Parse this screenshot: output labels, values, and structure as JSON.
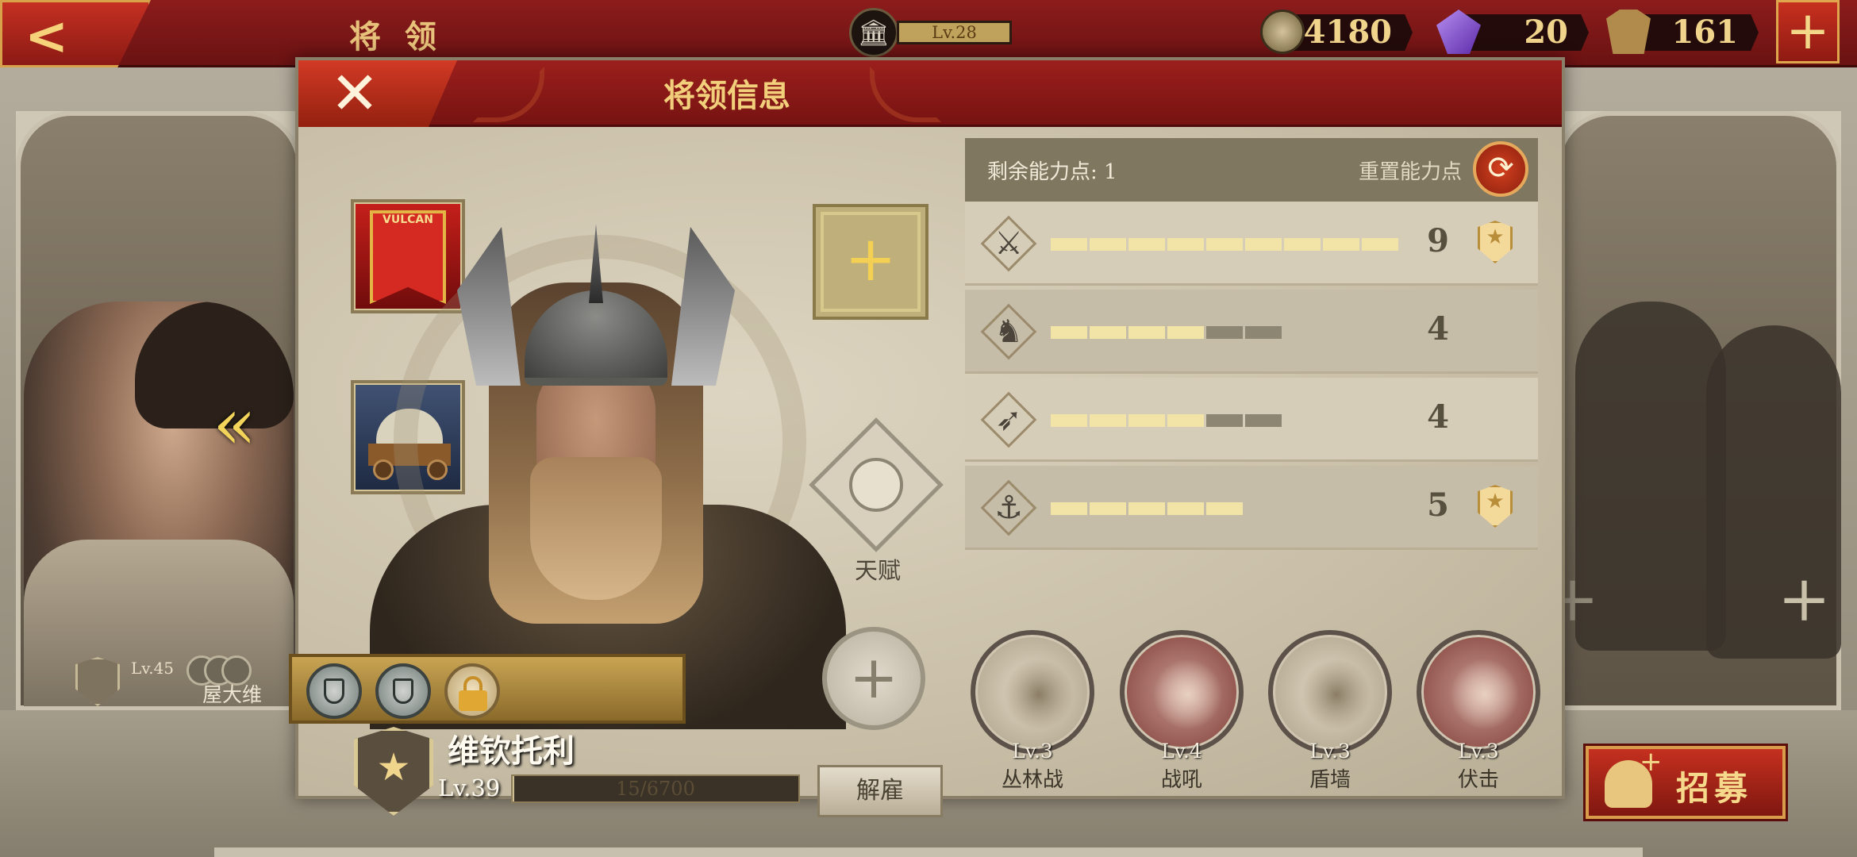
{
  "topbar": {
    "back_icon": "chevron-left-icon",
    "title": "将 领",
    "player_level": "Lv.28",
    "resources": [
      {
        "icon": "coin-icon",
        "value": "4180"
      },
      {
        "icon": "gem-icon",
        "value": "20"
      },
      {
        "icon": "spqr-token-icon",
        "value": "161"
      }
    ],
    "add_icon": "plus-icon"
  },
  "background": {
    "left_general": {
      "level": "Lv.45",
      "name": "屋大维"
    },
    "nav_arrow": "«"
  },
  "modal": {
    "title": "将领信息",
    "close_icon": "✕",
    "general": {
      "name": "维钦托利",
      "level": "Lv.39",
      "xp_text": "15/6700",
      "xp_fraction": 0.002,
      "rank_star": "★"
    },
    "equip_plus": "+",
    "talent_label": "天赋",
    "add_plus": "+",
    "dismiss_label": "解雇",
    "stats": {
      "remaining_label": "剩余能力点: 1",
      "reset_label": "重置能力点",
      "reset_icon": "⟳",
      "rows": [
        {
          "icon": "sword-icon",
          "glyph": "⚔",
          "value": "9",
          "max_pips": 9,
          "filled": 9,
          "badge": true
        },
        {
          "icon": "cavalry-icon",
          "glyph": "♞",
          "value": "4",
          "max_pips": 6,
          "filled": 4,
          "badge": false
        },
        {
          "icon": "bow-icon",
          "glyph": "➶",
          "value": "4",
          "max_pips": 6,
          "filled": 4,
          "badge": false
        },
        {
          "icon": "anchor-icon",
          "glyph": "⚓",
          "value": "5",
          "max_pips": 5,
          "filled": 5,
          "badge": true
        }
      ],
      "badge_star": "★"
    },
    "skills": [
      {
        "name": "丛林战",
        "level": "Lv.3",
        "style": "sand",
        "icon": "forest-icon"
      },
      {
        "name": "战吼",
        "level": "Lv.4",
        "style": "red",
        "icon": "warcry-icon"
      },
      {
        "name": "盾墙",
        "level": "Lv.3",
        "style": "sand",
        "icon": "shield-wall-icon"
      },
      {
        "name": "伏击",
        "level": "Lv.3",
        "style": "red",
        "icon": "ambush-icon"
      }
    ]
  },
  "recruit": {
    "label": "招募"
  },
  "colors": {
    "topbar_red": "#8c1c1c",
    "gold_text": "#f0d48c",
    "panel_sand": "#cbc2ab",
    "pip_on": "#f1e4a6",
    "pip_off": "#8d8672"
  }
}
